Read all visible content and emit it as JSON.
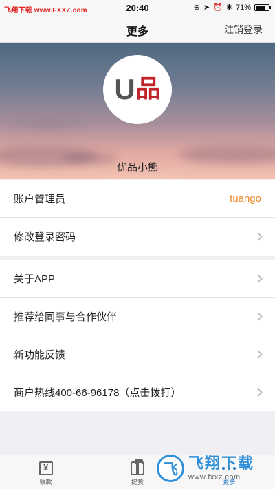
{
  "status_bar": {
    "watermark": "飞翔下载 www.FXXZ.com",
    "time": "20:40",
    "battery": "71%",
    "battery_level": 0.71
  },
  "nav": {
    "title": "更多",
    "action": "注销登录"
  },
  "profile": {
    "logo_letter": "U",
    "logo_char": "品",
    "name": "优品小熊"
  },
  "account_group": [
    {
      "label": "账户管理员",
      "value": "tuango"
    },
    {
      "label": "修改登录密码"
    }
  ],
  "menu_group": [
    {
      "label": "关于APP"
    },
    {
      "label": "推荐给同事与合作伙伴"
    },
    {
      "label": "新功能反馈"
    },
    {
      "label": "商户热线400-66-96178（点击拨打）"
    }
  ],
  "tabs": [
    {
      "label": "收款",
      "icon": "collect-icon"
    },
    {
      "label": "提货",
      "icon": "bag-icon"
    },
    {
      "label": "更多",
      "icon": "more-icon",
      "active": true
    }
  ],
  "watermark_logo": {
    "char": "飞",
    "text": "飞翔下载",
    "url": "www.fxxz.com"
  },
  "colors": {
    "accent_value": "#e98a2b",
    "active_tab": "#2477c9",
    "logo_red": "#c0232a"
  }
}
